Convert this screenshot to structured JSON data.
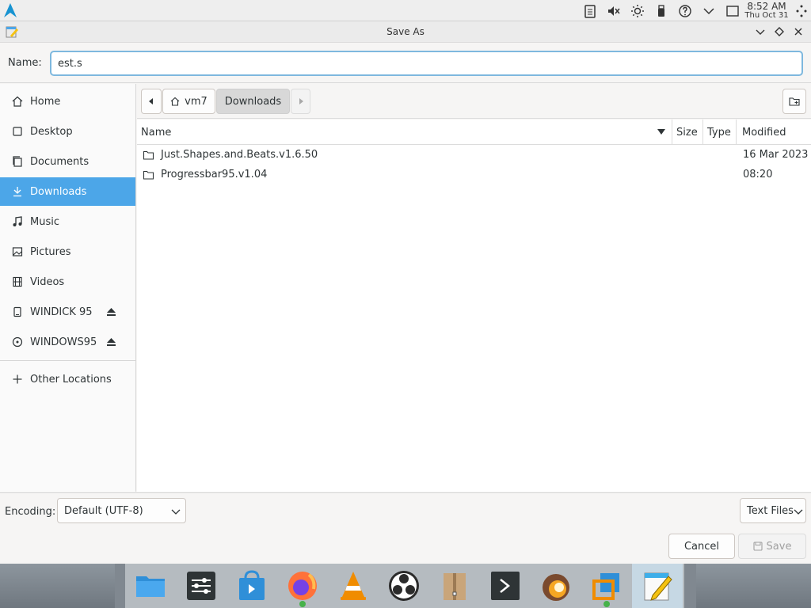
{
  "top_panel": {
    "logo_icon": "arch-logo",
    "tray_icons": [
      "clipboard-icon",
      "volume-muted-icon",
      "brightness-icon",
      "usb-drive-icon",
      "help-icon",
      "chevron-down-icon",
      "window-icon"
    ],
    "time": "8:52 AM",
    "date": "Thu Oct 31",
    "overflow_icon": "more-icon"
  },
  "window": {
    "title": "Save As",
    "app_icon": "text-editor-icon"
  },
  "name_row": {
    "label": "Name:",
    "value": "est.s"
  },
  "sidebar": {
    "items": [
      {
        "label": "Home",
        "icon": "home-icon",
        "active": false
      },
      {
        "label": "Desktop",
        "icon": "desktop-icon",
        "active": false
      },
      {
        "label": "Documents",
        "icon": "documents-icon",
        "active": false
      },
      {
        "label": "Downloads",
        "icon": "downloads-icon",
        "active": true
      },
      {
        "label": "Music",
        "icon": "music-icon",
        "active": false
      },
      {
        "label": "Pictures",
        "icon": "pictures-icon",
        "active": false
      },
      {
        "label": "Videos",
        "icon": "videos-icon",
        "active": false
      },
      {
        "label": "WINDICK 95",
        "icon": "drive-icon",
        "active": false,
        "eject": true
      },
      {
        "label": "WINDOWS95",
        "icon": "disc-icon",
        "active": false,
        "eject": true
      }
    ],
    "other_locations": "Other Locations"
  },
  "pathbar": {
    "segments": [
      "vm7",
      "Downloads"
    ],
    "current": "Downloads"
  },
  "columns": {
    "name": "Name",
    "size": "Size",
    "type": "Type",
    "modified": "Modified"
  },
  "files": [
    {
      "name": "Just.Shapes.and.Beats.v1.6.50",
      "modified": "16 Mar 2023"
    },
    {
      "name": "Progressbar95.v1.04",
      "modified": "08:20"
    }
  ],
  "bottom": {
    "encoding_label": "Encoding:",
    "encoding_value": "Default (UTF-8)",
    "filter_value": "Text Files",
    "cancel_label": "Cancel",
    "save_label": "Save"
  },
  "taskbar": {
    "apps": [
      "file-manager-icon",
      "settings-icon",
      "store-icon",
      "firefox-icon",
      "vlc-icon",
      "obs-icon",
      "archive-icon",
      "terminal-icon",
      "pidgin-icon",
      "virtualbox-icon",
      "text-editor-icon"
    ],
    "active": "text-editor-icon"
  },
  "colors": {
    "accent": "#4ca6e8",
    "input_focus": "#7eb8de"
  }
}
